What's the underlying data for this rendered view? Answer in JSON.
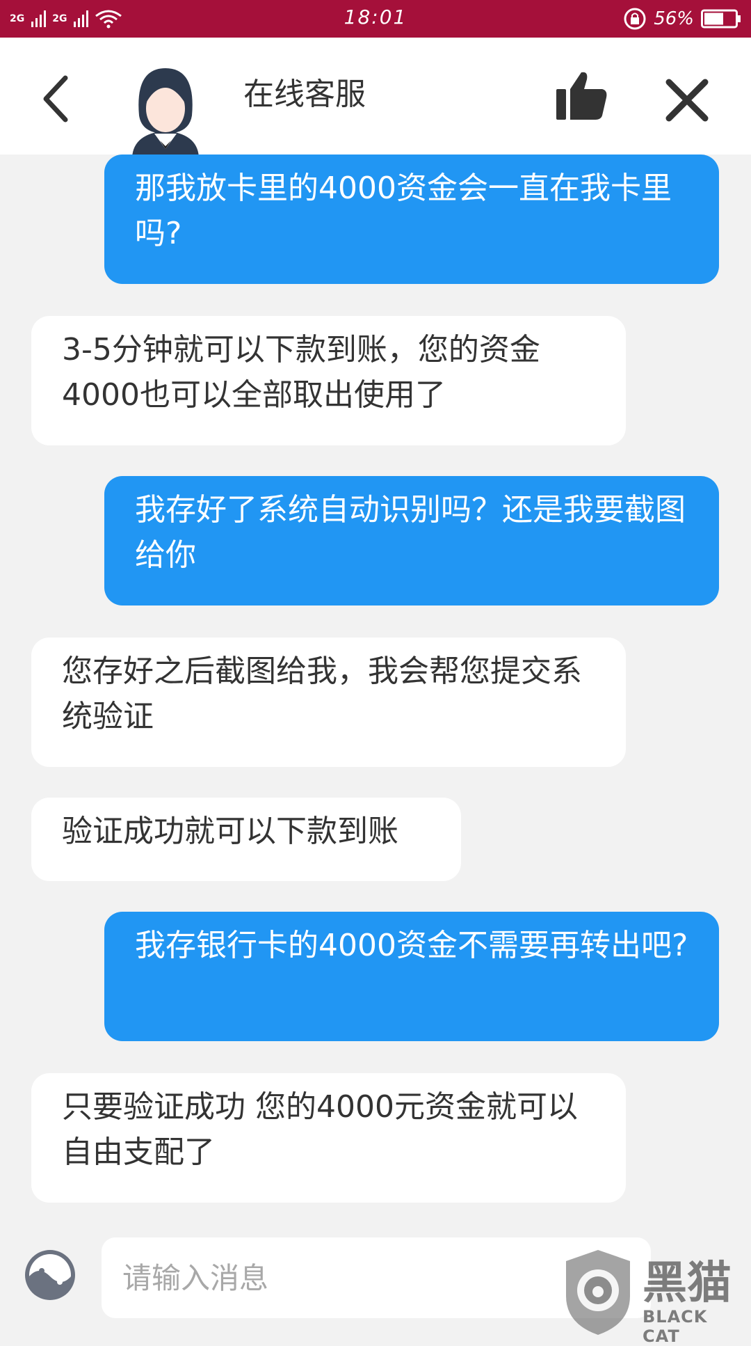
{
  "status_bar": {
    "network_1": "2G",
    "network_2": "2G",
    "time": "18:01",
    "battery": "56%",
    "background_color": "#a5103a"
  },
  "header": {
    "title": "在线客服",
    "icons": [
      "back-icon",
      "agent-avatar",
      "thumbs-up-icon",
      "close-icon"
    ]
  },
  "messages": [
    {
      "sender": "user",
      "text": "那我放卡里的4000资金会一直在我卡里吗?"
    },
    {
      "sender": "agent",
      "text": "3-5分钟就可以下款到账，您的资金4000也可以全部取出使用了"
    },
    {
      "sender": "user",
      "text": "我存好了系统自动识别吗？还是我要截图给你"
    },
    {
      "sender": "agent",
      "text": "您存好之后截图给我，我会帮您提交系统验证"
    },
    {
      "sender": "agent",
      "text": "验证成功就可以下款到账"
    },
    {
      "sender": "user",
      "text": "我存银行卡的4000资金不需要再转出吧?"
    },
    {
      "sender": "agent",
      "text": "只要验证成功 您的4000元资金就可以自由支配了"
    }
  ],
  "input": {
    "placeholder": "请输入消息",
    "value": ""
  },
  "watermark": {
    "text": "黑猫",
    "subtext": "BLACK CAT"
  },
  "colors": {
    "user_bubble": "#2196f3",
    "agent_bubble": "#ffffff",
    "chat_background": "#f2f2f2"
  }
}
